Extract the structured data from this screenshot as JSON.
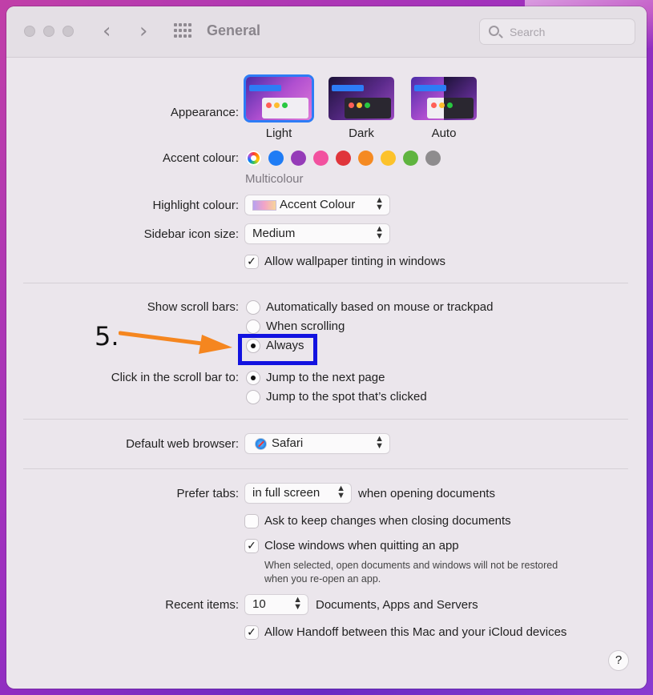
{
  "window": {
    "title": "General"
  },
  "search": {
    "placeholder": "Search"
  },
  "appearance": {
    "label": "Appearance:",
    "options": [
      {
        "label": "Light",
        "selected": true
      },
      {
        "label": "Dark",
        "selected": false
      },
      {
        "label": "Auto",
        "selected": false
      }
    ]
  },
  "accent": {
    "label": "Accent colour:",
    "selected_name": "Multicolour",
    "colors": [
      "multicolour",
      "#1f7cf5",
      "#953bb8",
      "#f2519f",
      "#e0353b",
      "#f58a22",
      "#fcc22b",
      "#5fb43f",
      "#8e8c8e"
    ]
  },
  "highlight": {
    "label": "Highlight colour:",
    "value": "Accent Colour"
  },
  "sidebar": {
    "label": "Sidebar icon size:",
    "value": "Medium"
  },
  "wallpaper_tinting": {
    "label": "Allow wallpaper tinting in windows",
    "checked": true
  },
  "scroll_bars": {
    "label": "Show scroll bars:",
    "options": [
      {
        "label": "Automatically based on mouse or trackpad",
        "selected": false
      },
      {
        "label": "When scrolling",
        "selected": false
      },
      {
        "label": "Always",
        "selected": true
      }
    ]
  },
  "click_scroll": {
    "label": "Click in the scroll bar to:",
    "options": [
      {
        "label": "Jump to the next page",
        "selected": true
      },
      {
        "label": "Jump to the spot that’s clicked",
        "selected": false
      }
    ]
  },
  "browser": {
    "label": "Default web browser:",
    "value": "Safari"
  },
  "tabs": {
    "label": "Prefer tabs:",
    "value": "in full screen",
    "suffix": "when opening documents"
  },
  "ask_keep": {
    "label": "Ask to keep changes when closing documents",
    "checked": false
  },
  "close_windows": {
    "label": "Close windows when quitting an app",
    "checked": true,
    "note_line1": "When selected, open documents and windows will not be restored",
    "note_line2": "when you re-open an app."
  },
  "recent": {
    "label": "Recent items:",
    "value": "10",
    "suffix": "Documents, Apps and Servers"
  },
  "handoff": {
    "label": "Allow Handoff between this Mac and your iCloud devices",
    "checked": true
  },
  "annotation": {
    "step": "5.",
    "arrow_color": "#f5861f",
    "box_color": "#1212e0"
  },
  "help": {
    "label": "?"
  },
  "traffic_lights": [
    "#cbc6cc",
    "#cbc6cc",
    "#cbc6cc"
  ]
}
